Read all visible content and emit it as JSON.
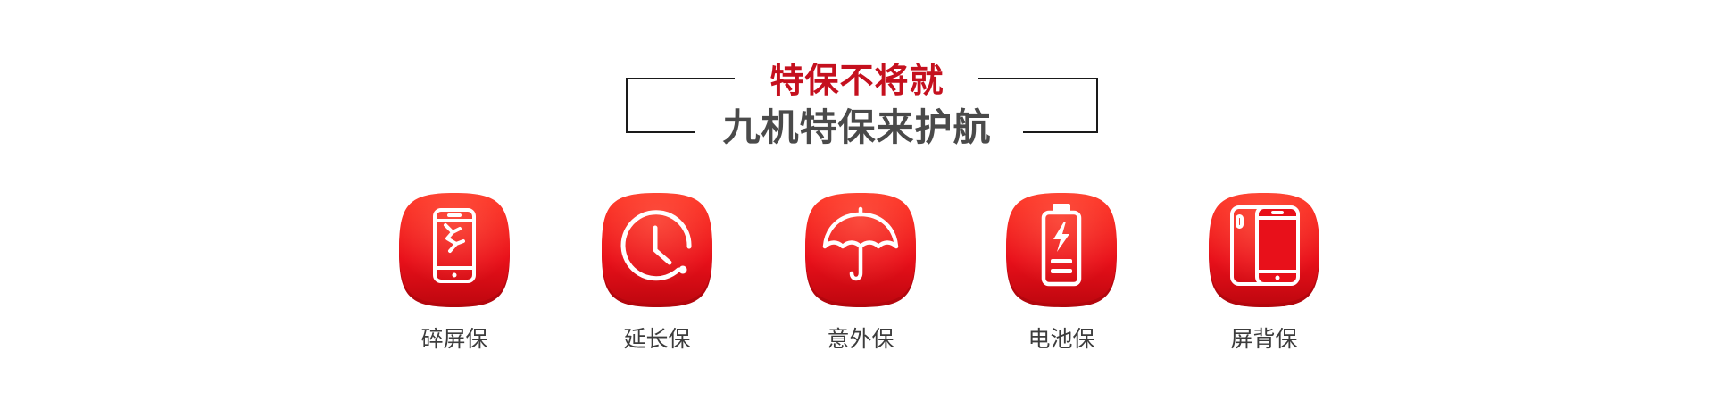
{
  "header": {
    "title_red": "特保不将就",
    "title_main": "九机特保来护航"
  },
  "colors": {
    "accent_red": "#c5101e",
    "badge_red_top": "#ff3b2b",
    "badge_red_bottom": "#c50a14",
    "title_dark": "#4a4a4a",
    "label_text": "#3c3c3c"
  },
  "features": [
    {
      "label": "碎屏保",
      "icon": "cracked-phone-icon"
    },
    {
      "label": "延长保",
      "icon": "clock-icon"
    },
    {
      "label": "意外保",
      "icon": "umbrella-icon"
    },
    {
      "label": "电池保",
      "icon": "battery-icon"
    },
    {
      "label": "屏背保",
      "icon": "phone-front-back-icon"
    }
  ]
}
